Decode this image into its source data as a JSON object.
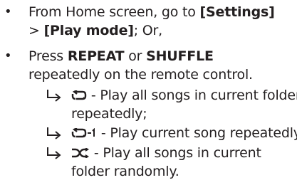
{
  "items": [
    {
      "bullet": "•",
      "line1_prefix": "From Home screen, go to ",
      "line1_bold": "[Settings]",
      "line2_prefix": "> ",
      "line2_bold": "[Play mode]",
      "line2_suffix": "; Or,"
    },
    {
      "bullet": "•",
      "line1_prefix": "Press ",
      "line1_bold1": "REPEAT",
      "line1_mid": " or ",
      "line1_bold2": "SHUFFLE",
      "line2": "repeatedly on the remote control."
    }
  ],
  "sub_items": [
    {
      "arrow_icon": "arrow-right-hook-icon",
      "symbol_icon": "repeat-all-icon",
      "line1": " - Play all songs in current folder",
      "line2": "repeatedly;"
    },
    {
      "arrow_icon": "arrow-right-hook-icon",
      "symbol_icon": "repeat-one-icon",
      "line1": " - Play current song repeatedly;"
    },
    {
      "arrow_icon": "arrow-right-hook-icon",
      "symbol_icon": "shuffle-icon",
      "line1": " - Play all songs in current",
      "line2": "folder randomly."
    }
  ]
}
